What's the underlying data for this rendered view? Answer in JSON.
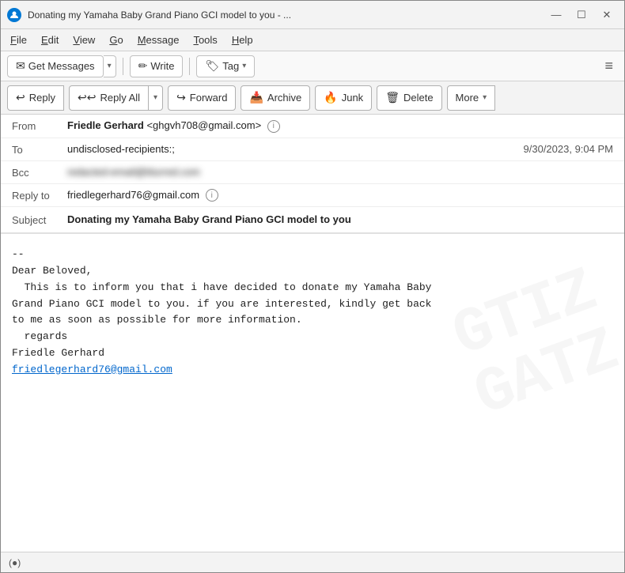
{
  "window": {
    "title": "Donating my Yamaha Baby Grand Piano GCI model to you - ...",
    "controls": {
      "minimize": "—",
      "maximize": "☐",
      "close": "✕"
    }
  },
  "menubar": {
    "items": [
      "File",
      "Edit",
      "View",
      "Go",
      "Message",
      "Tools",
      "Help"
    ]
  },
  "toolbar": {
    "get_messages_label": "Get Messages",
    "write_label": "Write",
    "tag_label": "Tag",
    "hamburger": "≡"
  },
  "actionbar": {
    "reply_label": "Reply",
    "reply_all_label": "Reply All",
    "forward_label": "Forward",
    "archive_label": "Archive",
    "junk_label": "Junk",
    "delete_label": "Delete",
    "more_label": "More"
  },
  "email": {
    "from_label": "From",
    "from_name": "Friedle Gerhard",
    "from_email": "<ghgvh708@gmail.com>",
    "to_label": "To",
    "to_value": "undisclosed-recipients:;",
    "date": "9/30/2023, 9:04 PM",
    "bcc_label": "Bcc",
    "bcc_value": "redacted@example.com",
    "reply_to_label": "Reply to",
    "reply_to_value": "friedlegerhard76@gmail.com",
    "subject_label": "Subject",
    "subject_value": "Donating my Yamaha Baby Grand Piano GCI model to you",
    "body_lines": [
      "--",
      "Dear Beloved,",
      "  This is to inform you that i have decided to donate my Yamaha Baby",
      "Grand Piano GCI model to you. if you are interested, kindly get back",
      "to me as soon as possible for more information.",
      "  regards",
      "Friedle Gerhard"
    ],
    "body_link": "friedlegerhard76@gmail.com",
    "body_link_href": "mailto:friedlegerhard76@gmail.com"
  },
  "statusbar": {
    "icon": "(●)",
    "text": ""
  }
}
